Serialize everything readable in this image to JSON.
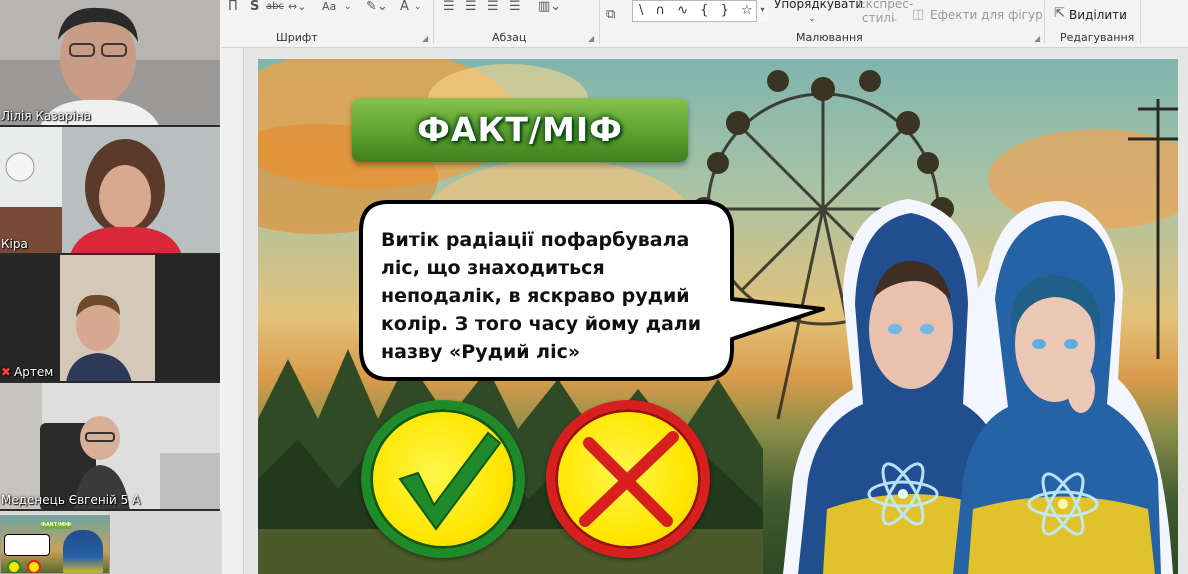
{
  "video_panel": {
    "participants": [
      {
        "name": "Лілія Казаріна",
        "muted": false
      },
      {
        "name": "Кіра",
        "muted": false
      },
      {
        "name": "Артем",
        "muted": true
      },
      {
        "name": "Меденець Євгеній 5 А",
        "muted": false
      }
    ]
  },
  "ribbon": {
    "groups": {
      "font": "Шрифт",
      "paragraph": "Абзац",
      "drawing": "Малювання",
      "editing": "Редагування"
    },
    "arrange_label": "Упорядкувати",
    "quick_styles_label_1": "Експрес-",
    "quick_styles_label_2": "стилі",
    "shape_effects_label": "Ефекти для фігур",
    "select_label": "Виділити",
    "font_icons": [
      "П",
      "S",
      "abc",
      "Aa",
      "A"
    ],
    "shapes_gallery": "\\ ∩ ∿ { } ☆"
  },
  "slide": {
    "title": "ФАКТ/МІФ",
    "statement": "Витік радіації пофарбувала ліс, що знаходиться неподалік, в яскраво рудий колір. З того часу йому дали назву «Рудий ліс»",
    "fact_button_icon": "check-mark-icon",
    "myth_button_icon": "cross-mark-icon"
  },
  "thumbnail": {
    "title": "ФАКТ/МІФ"
  },
  "colors": {
    "banner_green": "#5fa12f",
    "fact_ring": "#1f8a2a",
    "myth_ring": "#d81f1f",
    "button_yellow": "#ffe600"
  }
}
